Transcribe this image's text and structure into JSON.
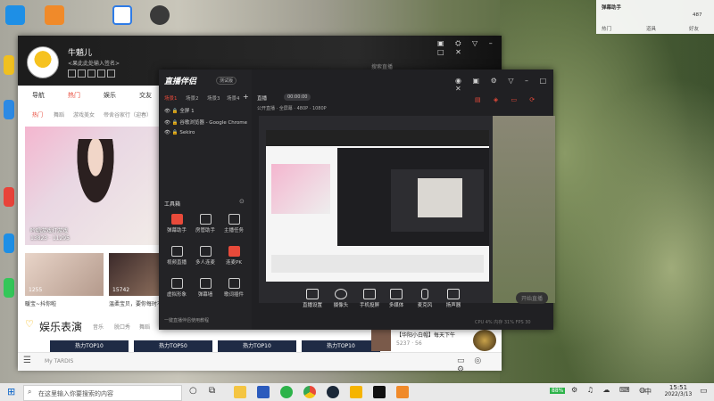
{
  "desktop": {
    "icons": [
      {
        "name": "qq-icon",
        "label": "QQ"
      },
      {
        "name": "app-icon-2",
        "label": ""
      },
      {
        "name": "feishu-icon",
        "label": ""
      },
      {
        "name": "steam-icon",
        "label": ""
      }
    ]
  },
  "left_app": {
    "username": "牛魈儿",
    "signature": "<果此此处输入签名>",
    "nav_tabs": [
      "导航",
      "热门",
      "娱乐",
      "交友"
    ],
    "sub_tabs": [
      "热门",
      "舞蹈",
      "游戏美女",
      "帝舍谷家行（迎春）"
    ],
    "big_card": {
      "tag": "热动",
      "title": "吟唱游戏打游戏",
      "viewers": "13823",
      "likes": "11295"
    },
    "cards": [
      {
        "count": "1255",
        "caption": "暖宝~抖你啦"
      },
      {
        "count": "15742",
        "caption": "温柔宝贝，要你每时不约"
      }
    ],
    "section_title": "娱乐表演",
    "section_tabs": [
      "音乐",
      "脱口秀",
      "舞蹈"
    ],
    "strips": [
      "热力TOP10",
      "热力TOP50",
      "热力TOP10",
      "热力TOP10"
    ],
    "live_item": {
      "title": "【华阳小白帽】每天下午",
      "v1": "5237",
      "v2": "56"
    },
    "bottom_label": "My TARDIS",
    "search_placeholder": "搜索直播"
  },
  "dark_app": {
    "logo": "直播伴侣",
    "logo_badge": "测试版",
    "side_tabs": [
      "场景1",
      "场景2",
      "场景3",
      "场景4"
    ],
    "sources": [
      "全屏 1",
      "谷歌浏览器 - Google Chrome",
      "Sekiro"
    ],
    "tools_title": "工具箱",
    "tools": [
      {
        "label": "弹幕助手",
        "red": true
      },
      {
        "label": "房管助手",
        "red": false
      },
      {
        "label": "主播任务",
        "red": false
      },
      {
        "label": "视频直播",
        "red": false
      },
      {
        "label": "多人连麦",
        "red": false
      },
      {
        "label": "连麦PK",
        "red": true
      },
      {
        "label": "虚拟形象",
        "red": false
      },
      {
        "label": "弹幕墙",
        "red": false
      },
      {
        "label": "歌词插件",
        "red": false
      }
    ],
    "footer_link": "一键直播伴侣使用教程",
    "title_tab": "直播",
    "status_chip": "00:00:00",
    "status_tags": [
      "公开直播",
      "全屏幕",
      "480P"
    ],
    "status_values": [
      "1080P",
      "0",
      "0"
    ],
    "controls": [
      "直播设置",
      "摄像头",
      "手机投屏",
      "多媒体",
      "麦克风",
      "扬声器"
    ],
    "start_button": "开始直播",
    "stats": "CPU 4%   内存 31%   FPS 30"
  },
  "right_panel": {
    "title": "弹幕助手",
    "count": "487",
    "items": [
      "热门",
      "道具",
      "好友"
    ]
  },
  "taskbar": {
    "search_placeholder": "在这里输入你要搜索的内容",
    "time": "15:51",
    "date": "2022/3/13",
    "battery": "88%",
    "ime": "中"
  },
  "colors": {
    "accent_red": "#e84a3a",
    "dark_bg": "#1b1b1d",
    "taskbar_bg": "#e9e9e9"
  }
}
